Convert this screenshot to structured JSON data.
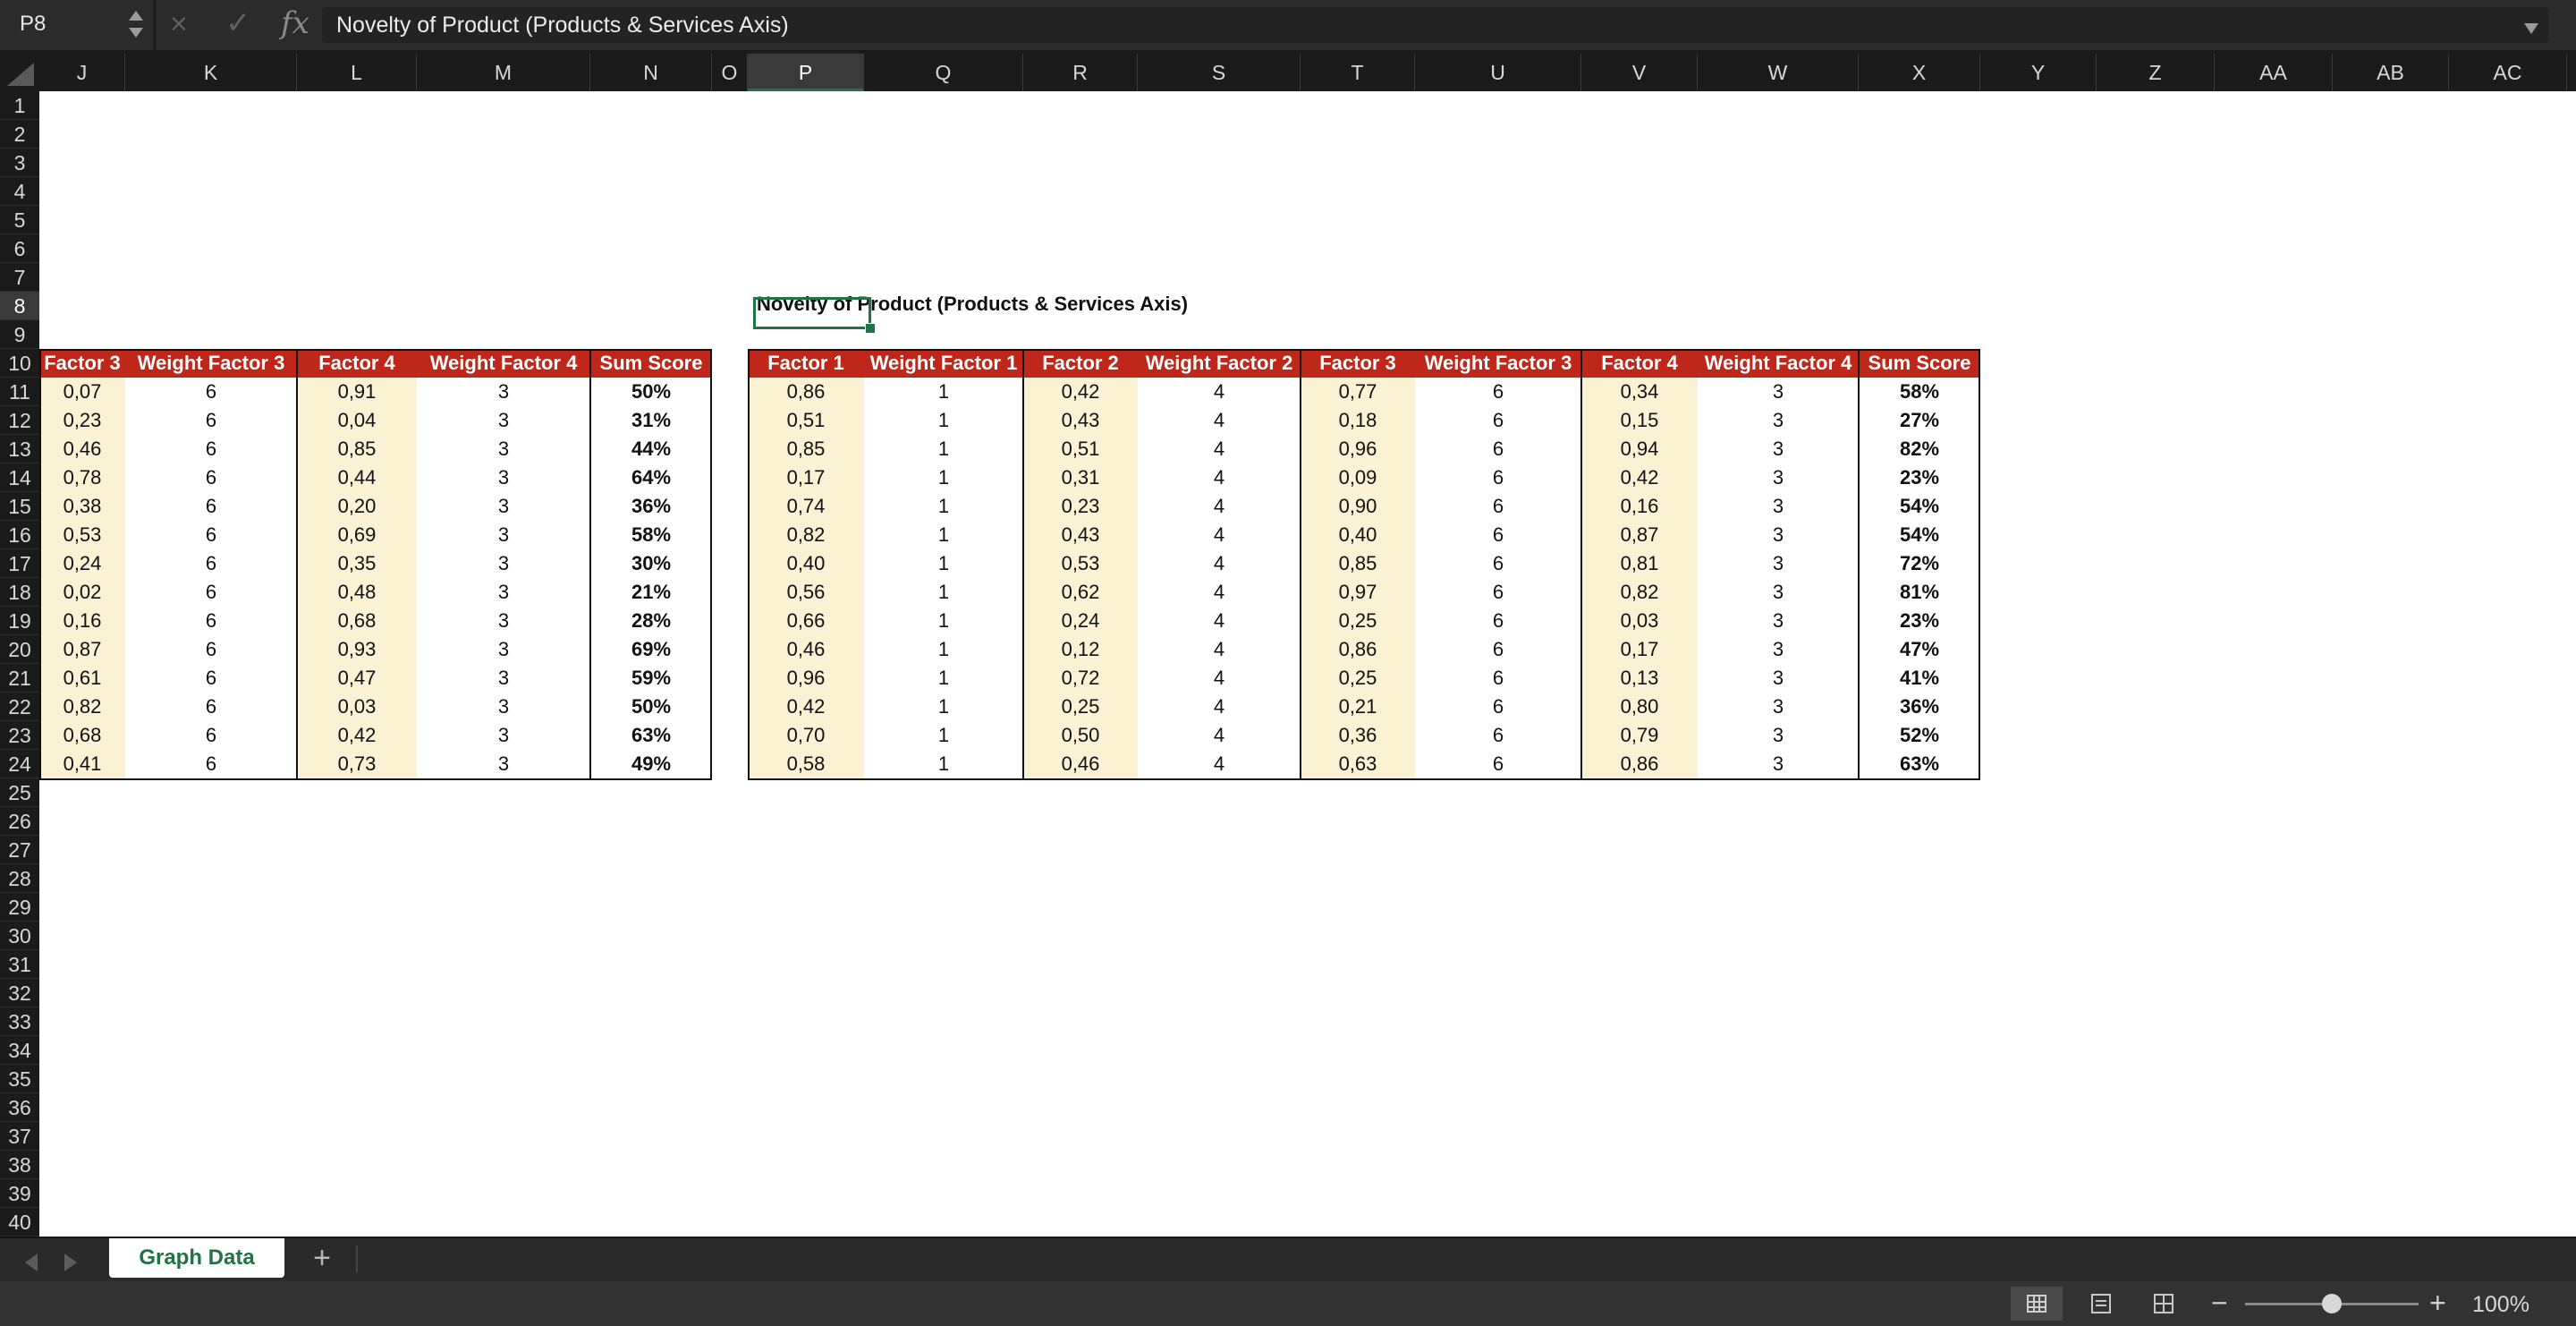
{
  "formula_bar": {
    "name_box": "P8",
    "cancel_icon": "×",
    "accept_icon": "✓",
    "fx_label": "fx",
    "formula": "Novelty of Product (Products & Services Axis)"
  },
  "columns": [
    "J",
    "K",
    "L",
    "M",
    "N",
    "O",
    "P",
    "Q",
    "R",
    "S",
    "T",
    "U",
    "V",
    "W",
    "X",
    "Y",
    "Z",
    "AA",
    "AB",
    "AC"
  ],
  "selected_column": "P",
  "rows": [
    "1",
    "2",
    "3",
    "4",
    "5",
    "6",
    "7",
    "8",
    "9",
    "10",
    "11",
    "12",
    "13",
    "14",
    "15",
    "16",
    "17",
    "18",
    "19",
    "20",
    "21",
    "22",
    "23",
    "24",
    "25",
    "26",
    "27",
    "28",
    "29",
    "30",
    "31",
    "32",
    "33",
    "34",
    "35",
    "36",
    "37",
    "38",
    "39",
    "40"
  ],
  "selected_row": "8",
  "title_cell": "Novelty of Product (Products & Services Axis)",
  "left_table": {
    "headers": [
      "Factor 3",
      "Weight Factor 3",
      "Factor 4",
      "Weight Factor 4",
      "Sum Score"
    ],
    "rows": [
      [
        "0,07",
        "6",
        "0,91",
        "3",
        "50%"
      ],
      [
        "0,23",
        "6",
        "0,04",
        "3",
        "31%"
      ],
      [
        "0,46",
        "6",
        "0,85",
        "3",
        "44%"
      ],
      [
        "0,78",
        "6",
        "0,44",
        "3",
        "64%"
      ],
      [
        "0,38",
        "6",
        "0,20",
        "3",
        "36%"
      ],
      [
        "0,53",
        "6",
        "0,69",
        "3",
        "58%"
      ],
      [
        "0,24",
        "6",
        "0,35",
        "3",
        "30%"
      ],
      [
        "0,02",
        "6",
        "0,48",
        "3",
        "21%"
      ],
      [
        "0,16",
        "6",
        "0,68",
        "3",
        "28%"
      ],
      [
        "0,87",
        "6",
        "0,93",
        "3",
        "69%"
      ],
      [
        "0,61",
        "6",
        "0,47",
        "3",
        "59%"
      ],
      [
        "0,82",
        "6",
        "0,03",
        "3",
        "50%"
      ],
      [
        "0,68",
        "6",
        "0,42",
        "3",
        "63%"
      ],
      [
        "0,41",
        "6",
        "0,73",
        "3",
        "49%"
      ]
    ]
  },
  "right_table": {
    "headers": [
      "Factor 1",
      "Weight Factor 1",
      "Factor 2",
      "Weight Factor 2",
      "Factor 3",
      "Weight Factor 3",
      "Factor 4",
      "Weight Factor 4",
      "Sum Score"
    ],
    "rows": [
      [
        "0,86",
        "1",
        "0,42",
        "4",
        "0,77",
        "6",
        "0,34",
        "3",
        "58%"
      ],
      [
        "0,51",
        "1",
        "0,43",
        "4",
        "0,18",
        "6",
        "0,15",
        "3",
        "27%"
      ],
      [
        "0,85",
        "1",
        "0,51",
        "4",
        "0,96",
        "6",
        "0,94",
        "3",
        "82%"
      ],
      [
        "0,17",
        "1",
        "0,31",
        "4",
        "0,09",
        "6",
        "0,42",
        "3",
        "23%"
      ],
      [
        "0,74",
        "1",
        "0,23",
        "4",
        "0,90",
        "6",
        "0,16",
        "3",
        "54%"
      ],
      [
        "0,82",
        "1",
        "0,43",
        "4",
        "0,40",
        "6",
        "0,87",
        "3",
        "54%"
      ],
      [
        "0,40",
        "1",
        "0,53",
        "4",
        "0,85",
        "6",
        "0,81",
        "3",
        "72%"
      ],
      [
        "0,56",
        "1",
        "0,62",
        "4",
        "0,97",
        "6",
        "0,82",
        "3",
        "81%"
      ],
      [
        "0,66",
        "1",
        "0,24",
        "4",
        "0,25",
        "6",
        "0,03",
        "3",
        "23%"
      ],
      [
        "0,46",
        "1",
        "0,12",
        "4",
        "0,86",
        "6",
        "0,17",
        "3",
        "47%"
      ],
      [
        "0,96",
        "1",
        "0,72",
        "4",
        "0,25",
        "6",
        "0,13",
        "3",
        "41%"
      ],
      [
        "0,42",
        "1",
        "0,25",
        "4",
        "0,21",
        "6",
        "0,80",
        "3",
        "36%"
      ],
      [
        "0,70",
        "1",
        "0,50",
        "4",
        "0,36",
        "6",
        "0,79",
        "3",
        "52%"
      ],
      [
        "0,58",
        "1",
        "0,46",
        "4",
        "0,63",
        "6",
        "0,86",
        "3",
        "63%"
      ]
    ]
  },
  "sheet_tabs": [
    "Graph Data"
  ],
  "add_sheet_label": "+",
  "status_bar": {
    "zoom_out_label": "−",
    "zoom_in_label": "+",
    "zoom_level": "100%",
    "zoom_fraction": 0.5
  },
  "colors": {
    "header_fill": "#c0271b",
    "factor_fill": "#fbf1d3",
    "selection": "#217346"
  }
}
